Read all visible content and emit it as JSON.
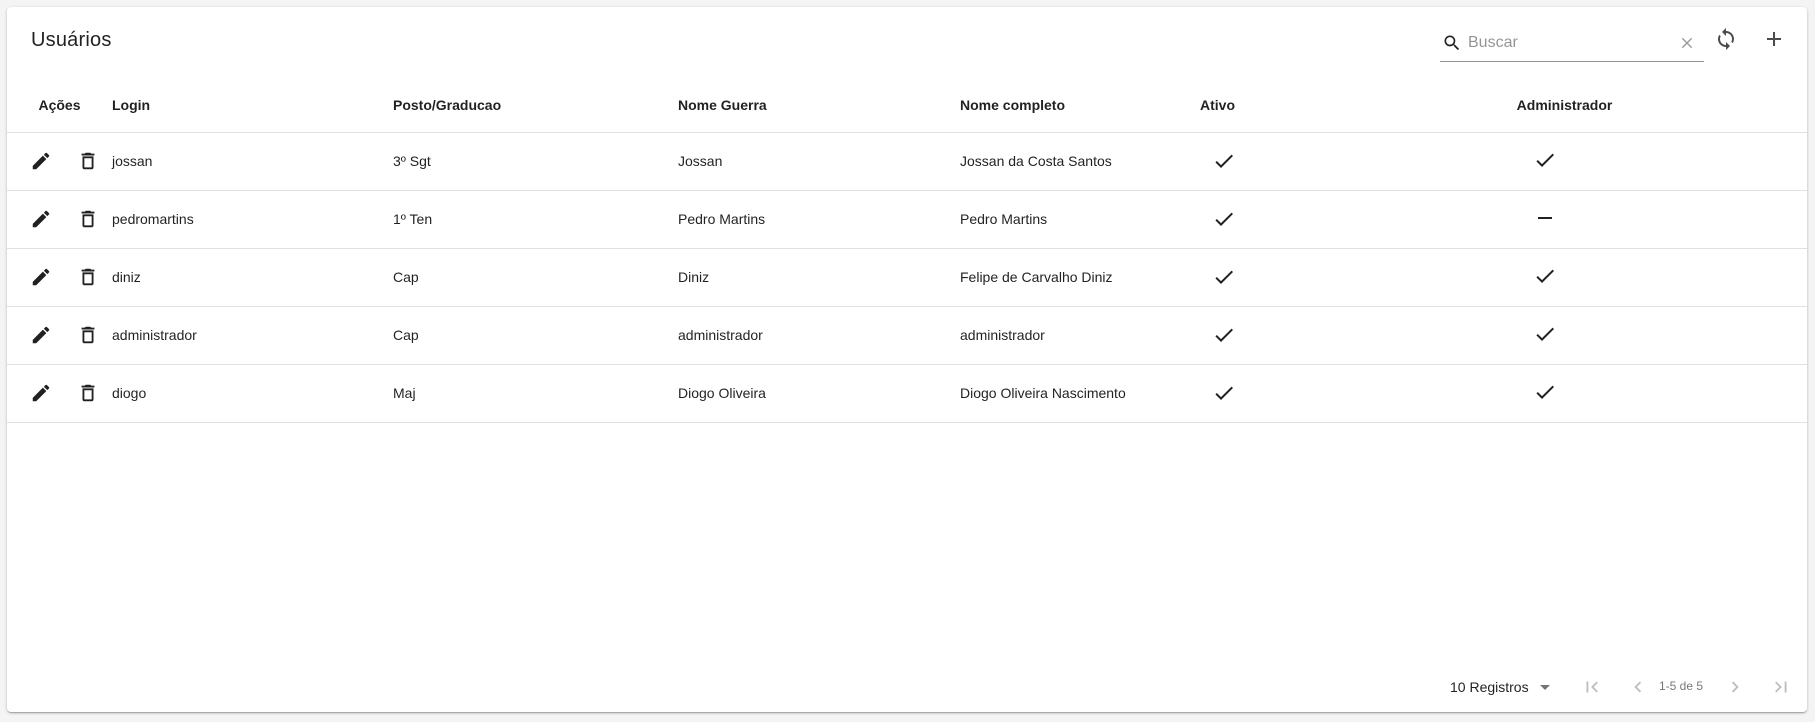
{
  "header": {
    "title": "Usuários",
    "search_placeholder": "Buscar",
    "search_value": ""
  },
  "table": {
    "columns": [
      "Ações",
      "Login",
      "Posto/Graducao",
      "Nome Guerra",
      "Nome completo",
      "Ativo",
      "Administrador"
    ],
    "rows": [
      {
        "login": "jossan",
        "posto": "3º Sgt",
        "nome_guerra": "Jossan",
        "nome_completo": "Jossan da Costa Santos",
        "ativo": true,
        "administrador": true
      },
      {
        "login": "pedromartins",
        "posto": "1º Ten",
        "nome_guerra": "Pedro Martins",
        "nome_completo": "Pedro Martins",
        "ativo": true,
        "administrador": false
      },
      {
        "login": "diniz",
        "posto": "Cap",
        "nome_guerra": "Diniz",
        "nome_completo": "Felipe de Carvalho Diniz",
        "ativo": true,
        "administrador": true
      },
      {
        "login": "administrador",
        "posto": "Cap",
        "nome_guerra": "administrador",
        "nome_completo": "administrador",
        "ativo": true,
        "administrador": true
      },
      {
        "login": "diogo",
        "posto": "Maj",
        "nome_guerra": "Diogo Oliveira",
        "nome_completo": "Diogo Oliveira Nascimento",
        "ativo": true,
        "administrador": true
      }
    ],
    "row_action_icons": [
      "edit-icon",
      "delete-icon"
    ]
  },
  "toolbar": {
    "icons": [
      "search-icon",
      "clear-icon",
      "refresh-icon",
      "add-icon"
    ]
  },
  "footer": {
    "rows_per_page": "10 Registros",
    "page_info": "1-5 de 5",
    "pagination_icons": [
      "first-page-icon",
      "previous-page-icon",
      "next-page-icon",
      "last-page-icon"
    ]
  },
  "colors": {
    "background": "#f4f4f4",
    "card": "#ffffff",
    "text": "#212121",
    "divider": "#e0e0e0"
  }
}
